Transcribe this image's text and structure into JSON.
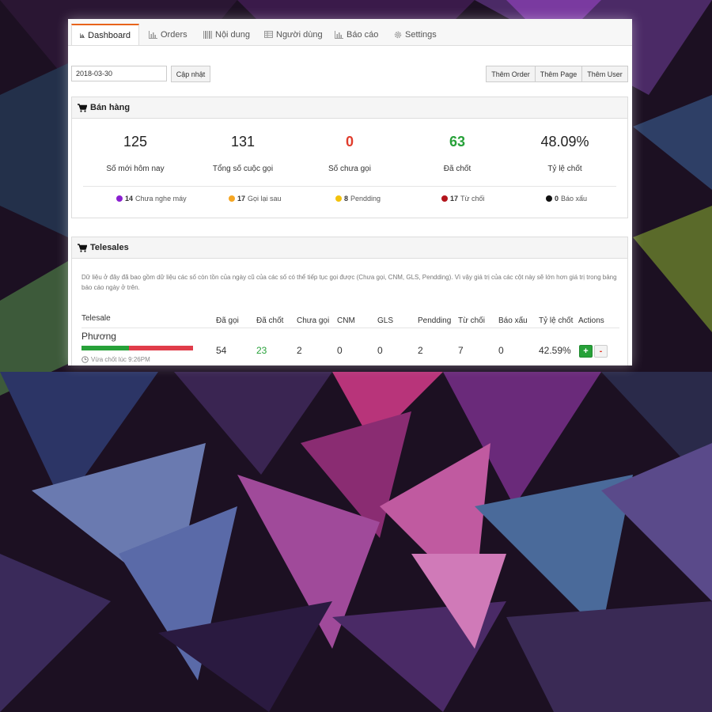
{
  "colors": {
    "accent": "#e8641b",
    "green": "#27a139",
    "red": "#e03c2c",
    "purple": "#8a1fd0",
    "orange": "#f5a623",
    "yellow": "#f3c20c",
    "darkred": "#b3141c",
    "black": "#111111"
  },
  "tabs": [
    {
      "label": "Dashboard",
      "icon": "bar-chart-icon"
    },
    {
      "label": "Orders",
      "icon": "bar-chart-icon"
    },
    {
      "label": "Nội dung",
      "icon": "barcode-icon"
    },
    {
      "label": "Người dùng",
      "icon": "table-icon"
    },
    {
      "label": "Báo cáo",
      "icon": "bar-chart-icon"
    },
    {
      "label": "Settings",
      "icon": "gear-icon"
    }
  ],
  "filter": {
    "date_value": "2018-03-30",
    "update_label": "Cập nhật"
  },
  "actions": {
    "add_order": "Thêm Order",
    "add_page": "Thêm Page",
    "add_user": "Thêm User"
  },
  "sales": {
    "title": "Bán hàng",
    "stats": [
      {
        "value": "125",
        "label": "Số mới hôm nay"
      },
      {
        "value": "131",
        "label": "Tổng số cuộc gọi"
      },
      {
        "value": "0",
        "label": "Số chưa gọi"
      },
      {
        "value": "63",
        "label": "Đã chốt"
      },
      {
        "value": "48.09%",
        "label": "Tỷ lệ chốt"
      }
    ],
    "legend": [
      {
        "count": "14",
        "label": "Chưa nghe máy"
      },
      {
        "count": "17",
        "label": "Gọi lại sau"
      },
      {
        "count": "8",
        "label": "Pendding"
      },
      {
        "count": "17",
        "label": "Từ chối"
      },
      {
        "count": "0",
        "label": "Báo xấu"
      }
    ]
  },
  "telesales": {
    "title": "Telesales",
    "note": "Dữ liệu ở đây đã bao gồm dữ liệu các số còn tồn của ngày cũ của các số có thể tiếp tục gọi được (Chưa gọi, CNM, GLS, Pendding). Vì vậy giá trị của các cột này sẽ lớn hơn giá trị trong bảng báo cáo ngày ở trên.",
    "headers": [
      "Telesale",
      "Đã gọi",
      "Đã chốt",
      "Chưa gọi",
      "CNM",
      "GLS",
      "Pendding",
      "Từ chối",
      "Báo xấu",
      "Tỷ lệ chốt",
      "Actions"
    ],
    "rows": [
      {
        "name": "Phương",
        "progress_closed": 0.426,
        "last_closed": "Vừa chốt lúc 9:26PM",
        "called": "54",
        "closed": "23",
        "not_called": "2",
        "cnm": "0",
        "gls": "0",
        "pending": "2",
        "rejected": "7",
        "bad": "0",
        "rate": "42.59%",
        "plus": "+",
        "minus": "-"
      }
    ]
  }
}
